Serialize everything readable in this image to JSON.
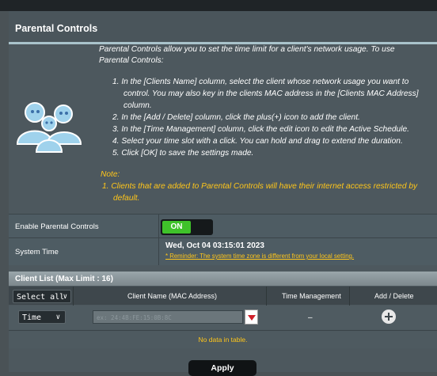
{
  "panel": {
    "title": "Parental Controls",
    "intro": "Parental Controls allow you to set the time limit for a client's network usage. To use Parental Controls:",
    "steps": [
      "1. In the [Clients Name] column, select the client whose network usage you want to control. You may also key in the clients MAC address in the [Clients MAC Address] column.",
      "2. In the [Add / Delete] column, click the plus(+) icon to add the client.",
      "3. In the [Time Management] column, click the edit icon to edit the Active Schedule.",
      "4. Select your time slot with a click. You can hold and drag to extend the duration.",
      "5. Click [OK] to save the settings made."
    ],
    "note_label": "Note:",
    "note_items": [
      "1. Clients that are added to Parental Controls will have their internet access restricted by default."
    ]
  },
  "settings": {
    "enable_label": "Enable Parental Controls",
    "enable_state": "ON",
    "system_time_label": "System Time",
    "system_time_value": "Wed, Oct 04 03:15:01 2023",
    "reminder": "* Reminder: The system time zone is different from your local setting."
  },
  "client_list": {
    "header": "Client List (Max Limit : 16)",
    "select_all": "Select all",
    "columns": [
      "Client Name (MAC Address)",
      "Time Management",
      "Add / Delete"
    ],
    "row": {
      "mode": "Time",
      "mac_placeholder": "ex: 24:4B:FE:15:0B:8C",
      "time_value": "–"
    },
    "empty_text": "No data in table."
  },
  "footer": {
    "apply_label": "Apply"
  },
  "colors": {
    "toggle_on": "#3fc22a",
    "accent_yellow": "#ffc61a"
  }
}
